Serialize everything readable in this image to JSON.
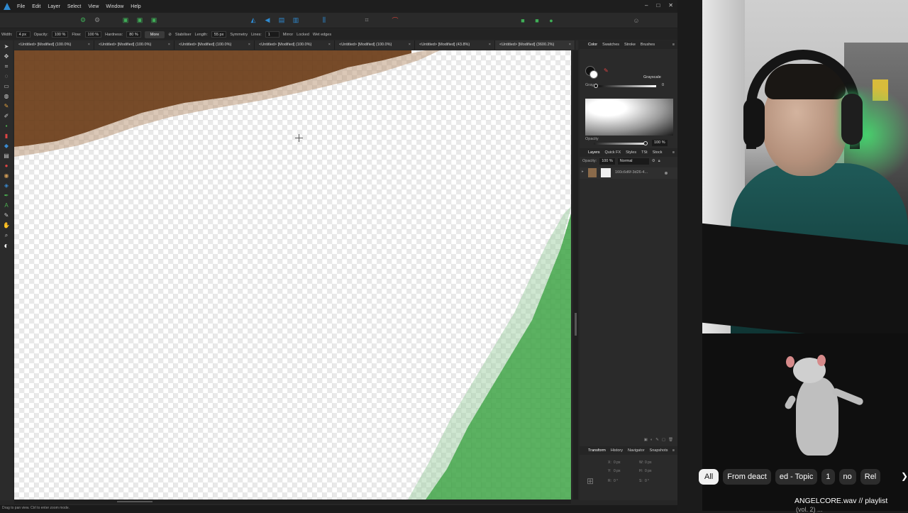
{
  "menu": {
    "items": [
      "File",
      "Edit",
      "Layer",
      "Select",
      "View",
      "Window",
      "Help"
    ]
  },
  "context_toolbar": {
    "width_label": "Width:",
    "width_value": "4 px",
    "opacity_label": "Opacity:",
    "opacity_value": "100 %",
    "flow_label": "Flow:",
    "flow_value": "100 %",
    "hardness_label": "Hardness:",
    "hardness_value": "80 %",
    "more_label": "More",
    "stabiliser_label": "Stabiliser",
    "length_label": "Length:",
    "length_value": "55 px",
    "symmetry_label": "Symmetry",
    "lines_label": "Lines:",
    "lines_value": "1",
    "mirror_label": "Mirror",
    "locked_label": "Locked",
    "wet_edges_label": "Wet edges"
  },
  "tabs": [
    "<Untitled> [Modified] (100.0%)",
    "<Untitled> [Modified] (100.0%)",
    "<Untitled> [Modified] (100.0%)",
    "<Untitled> [Modified] (100.0%)",
    "<Untitled> [Modified] (100.0%)",
    "<Untitled> [Modified] (43.8%)",
    "<Untitled> [Modified] (3600.2%)"
  ],
  "color_panel": {
    "tabs": [
      "Color",
      "Swatches",
      "Stroke",
      "Brushes"
    ],
    "mode": "Grayscale",
    "gray_label": "Gray",
    "gray_value": "0",
    "opacity_label": "Opacity",
    "opacity_value": "100 %"
  },
  "layers_panel": {
    "tabs": [
      "Layers",
      "Quick FX",
      "Styles",
      "TSt",
      "Stock"
    ],
    "opacity_label": "Opacity:",
    "opacity_value": "100 %",
    "blend_mode": "Normal",
    "layer_name": "160c6d6f-3d26-4..."
  },
  "transform_panel": {
    "tabs": [
      "Transform",
      "History",
      "Navigator",
      "Snapshots"
    ],
    "x_label": "X:",
    "x_value": "0 px",
    "y_label": "Y:",
    "y_value": "0 px",
    "w_label": "W:",
    "w_value": "0 px",
    "h_label": "H:",
    "h_value": "0 px",
    "r_label": "R:",
    "r_value": "0 °",
    "s_label": "S:",
    "s_value": "0 °"
  },
  "status_bar": "Drag to pan view. Ctrl to enter zoom mode.",
  "youtube": {
    "chips": [
      "All",
      "From deact",
      "ed - Topic",
      "1",
      "no",
      "Rel"
    ],
    "title": "ANGELCORE.wav // playlist",
    "subtitle": "(vol. 2) ..."
  },
  "colors": {
    "accent": "#2f8ad0",
    "brush_brown": "#6b3c17",
    "canvas_green": "#3fa447",
    "yt_chip_active": "#f1f1f1"
  }
}
